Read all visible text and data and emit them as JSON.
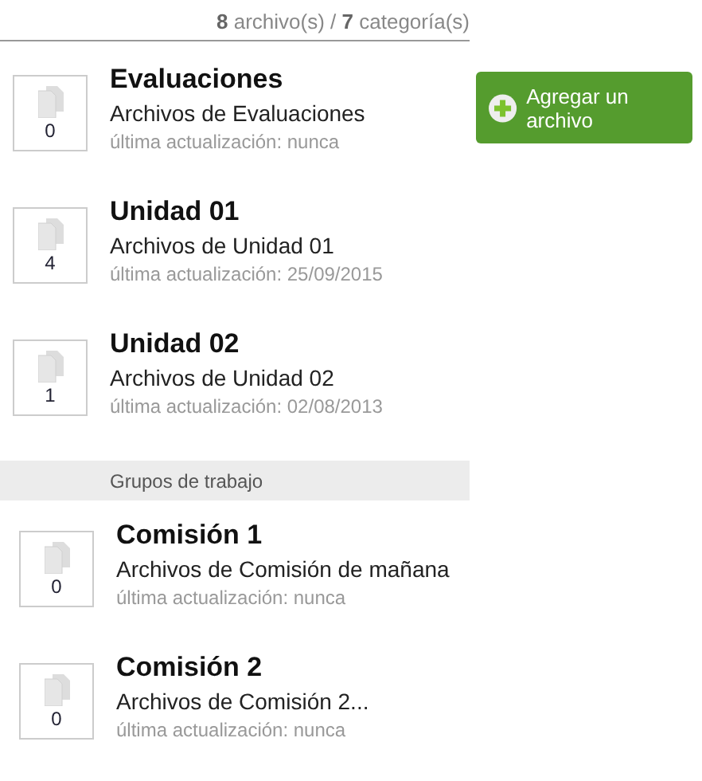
{
  "summary": "**8** archivo(s) / **7** categoría(s)",
  "add_button": {
    "label": "Agregar un archivo"
  },
  "categories": [
    {
      "title": "Evaluaciones",
      "description": "Archivos de Evaluaciones",
      "updated": "última actualización: nunca",
      "count": "0"
    },
    {
      "title": "Unidad 01",
      "description": "Archivos de Unidad 01",
      "updated": "última actualización: 25/09/2015",
      "count": "4"
    },
    {
      "title": "Unidad 02",
      "description": "Archivos de Unidad 02",
      "updated": "última actualización: 02/08/2013",
      "count": "1"
    }
  ],
  "group_section": {
    "heading": "Grupos de trabajo",
    "items": [
      {
        "title": "Comisión 1",
        "description": "Archivos de Comisión de mañana",
        "updated": "última actualización: nunca",
        "count": "0"
      },
      {
        "title": "Comisión 2",
        "description": "Archivos de Comisión 2...",
        "updated": "última actualización: nunca",
        "count": "0"
      }
    ]
  }
}
